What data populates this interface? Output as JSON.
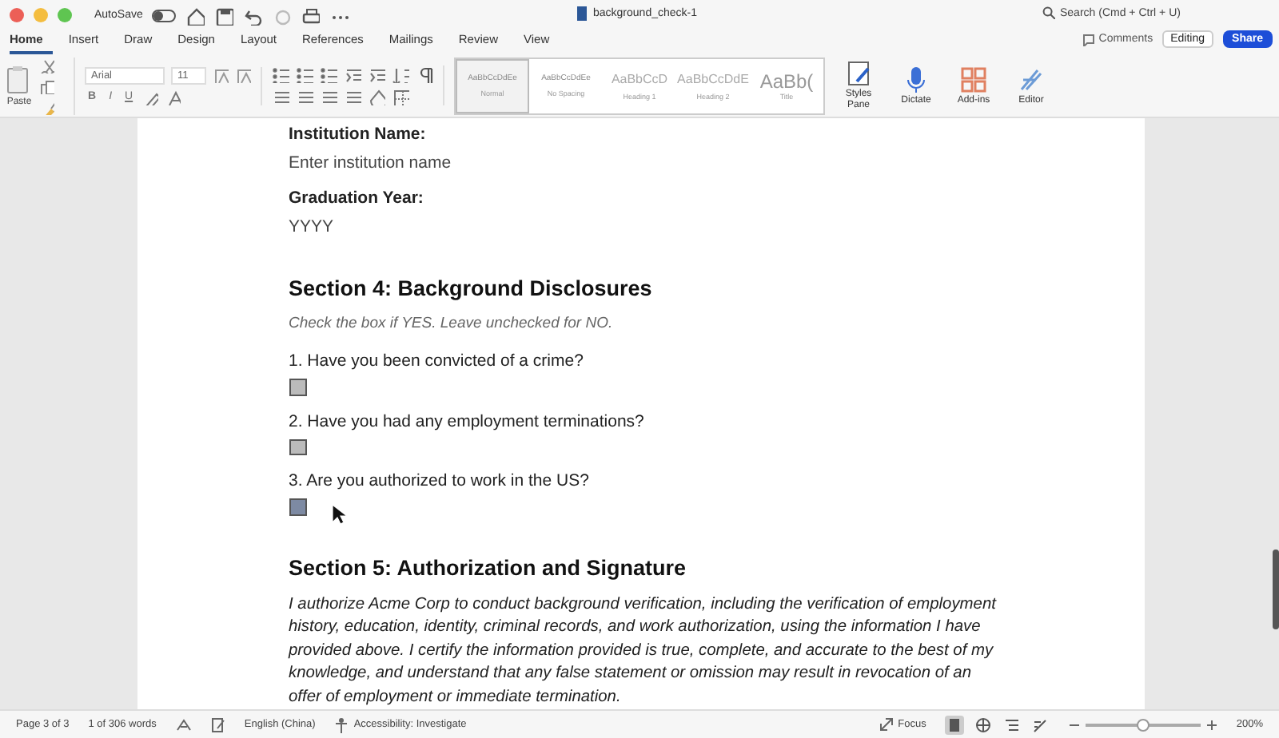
{
  "window": {
    "title": "background_check-1",
    "autosave": {
      "label": "AutoSave",
      "on": false
    },
    "search_placeholder": "Search (Cmd + Ctrl + U)"
  },
  "tabs": [
    {
      "label": "Home",
      "selected": true
    },
    {
      "label": "Insert",
      "selected": false
    },
    {
      "label": "Draw",
      "selected": false
    },
    {
      "label": "Design",
      "selected": false
    },
    {
      "label": "Layout",
      "selected": false
    },
    {
      "label": "References",
      "selected": false
    },
    {
      "label": "Mailings",
      "selected": false
    },
    {
      "label": "Review",
      "selected": false
    },
    {
      "label": "View",
      "selected": false
    }
  ],
  "actions": {
    "comments": "Comments",
    "editing": "Editing",
    "share": "Share"
  },
  "ribbon": {
    "paste": "Paste",
    "font": "Arial",
    "size": "11",
    "format_buttons": [
      "B",
      "I",
      "U"
    ],
    "styles": [
      {
        "sample": "AaBbCcDdEe",
        "name": "Normal",
        "selected": true
      },
      {
        "sample": "AaBbCcDdEe",
        "name": "No Spacing",
        "selected": false
      },
      {
        "sample": "AaBbCcD",
        "name": "Heading 1",
        "selected": false
      },
      {
        "sample": "AaBbCcDdE",
        "name": "Heading 2",
        "selected": false
      },
      {
        "sample": "AaBb(",
        "name": "Title",
        "selected": false
      }
    ],
    "buttons": [
      {
        "kind": "styles",
        "label": "Styles Pane"
      },
      {
        "kind": "dictate",
        "label": "Dictate"
      },
      {
        "kind": "addins",
        "label": "Add-ins"
      },
      {
        "kind": "editor",
        "label": "Editor"
      }
    ]
  },
  "document": [
    {
      "kind": "label",
      "text": "Institution Name:"
    },
    {
      "kind": "field",
      "text": "Enter institution name"
    },
    {
      "kind": "label",
      "text": "Graduation Year:"
    },
    {
      "kind": "field",
      "text": "YYYY"
    },
    {
      "kind": "heading",
      "text": "Section 4: Background Disclosures"
    },
    {
      "kind": "note",
      "text": "Check the box if YES. Leave unchecked for NO."
    },
    {
      "kind": "question",
      "text": "1. Have you been convicted of a crime?",
      "checked": false
    },
    {
      "kind": "question",
      "text": "2. Have you had any employment terminations?",
      "checked": false
    },
    {
      "kind": "question",
      "text": "3. Are you authorized to work in the US?",
      "checked": true
    },
    {
      "kind": "heading",
      "text": "Section 5: Authorization and Signature"
    },
    {
      "kind": "paragraph",
      "text": "I authorize Acme Corp to conduct background verification, including the verification of employment history, education, identity, criminal records, and work authorization, using the information I have provided above. I certify the information provided is true, complete, and accurate to the best of my knowledge, and understand that any false statement or omission may result in revocation of an offer of employment or immediate termination."
    }
  ],
  "status_bar": {
    "page": "Page 3 of 3",
    "words": "1 of 306 words",
    "language": "English (China)",
    "accessibility": "Accessibility: Investigate",
    "focus": "Focus",
    "views": [
      {
        "kind": "print",
        "selected": true
      },
      {
        "kind": "web",
        "selected": false
      },
      {
        "kind": "outline",
        "selected": false
      },
      {
        "kind": "draft",
        "selected": false
      }
    ],
    "zoom_slider": {
      "level": 0.5
    },
    "zoom": "200%"
  }
}
